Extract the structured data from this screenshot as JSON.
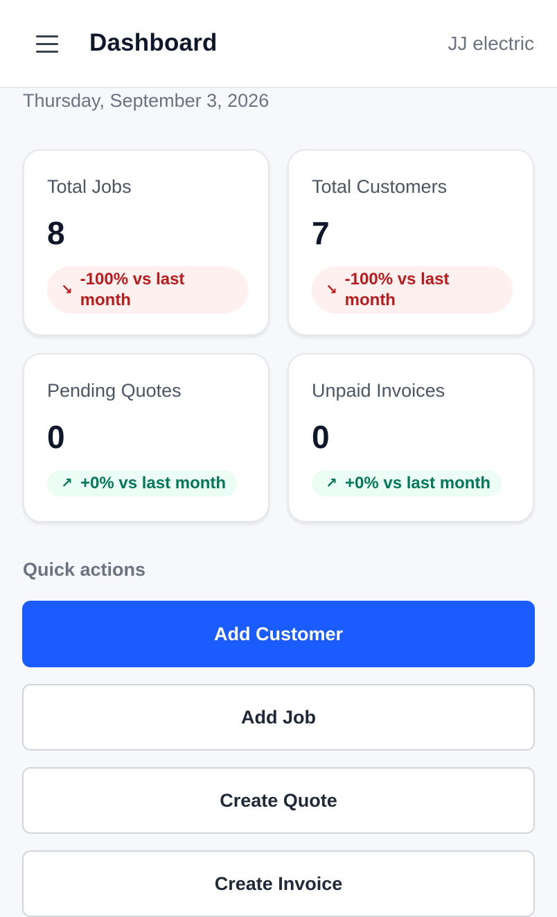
{
  "header": {
    "title": "Dashboard",
    "company": "JJ electric",
    "menu_icon": "hamburger-menu-icon"
  },
  "date": "Thursday, September 3, 2026",
  "stats": [
    {
      "label": "Total Jobs",
      "value": "8",
      "trend": "-100% vs last month",
      "trend_icon": "arrow-down-right-icon",
      "trend_glyph": "↘",
      "trend_direction": "down"
    },
    {
      "label": "Total Customers",
      "value": "7",
      "trend": "-100% vs last month",
      "trend_icon": "arrow-down-right-icon",
      "trend_glyph": "↘",
      "trend_direction": "down"
    },
    {
      "label": "Pending Quotes",
      "value": "0",
      "trend": "+0% vs last month",
      "trend_icon": "arrow-up-right-icon",
      "trend_glyph": "↗",
      "trend_direction": "up"
    },
    {
      "label": "Unpaid Invoices",
      "value": "0",
      "trend": "+0% vs last month",
      "trend_icon": "arrow-up-right-icon",
      "trend_glyph": "↗",
      "trend_direction": "up"
    }
  ],
  "quick_actions": {
    "title": "Quick actions",
    "buttons": [
      {
        "label": "Add Customer"
      },
      {
        "label": "Add Job"
      },
      {
        "label": "Create Quote"
      },
      {
        "label": "Create Invoice"
      }
    ]
  },
  "colors": {
    "primary": "#1a5cff",
    "negative_text": "#b91c1c",
    "negative_bg": "#fff0f0",
    "positive_text": "#047857",
    "positive_bg": "#ecfdf5",
    "page_bg": "#f6f8fb"
  }
}
